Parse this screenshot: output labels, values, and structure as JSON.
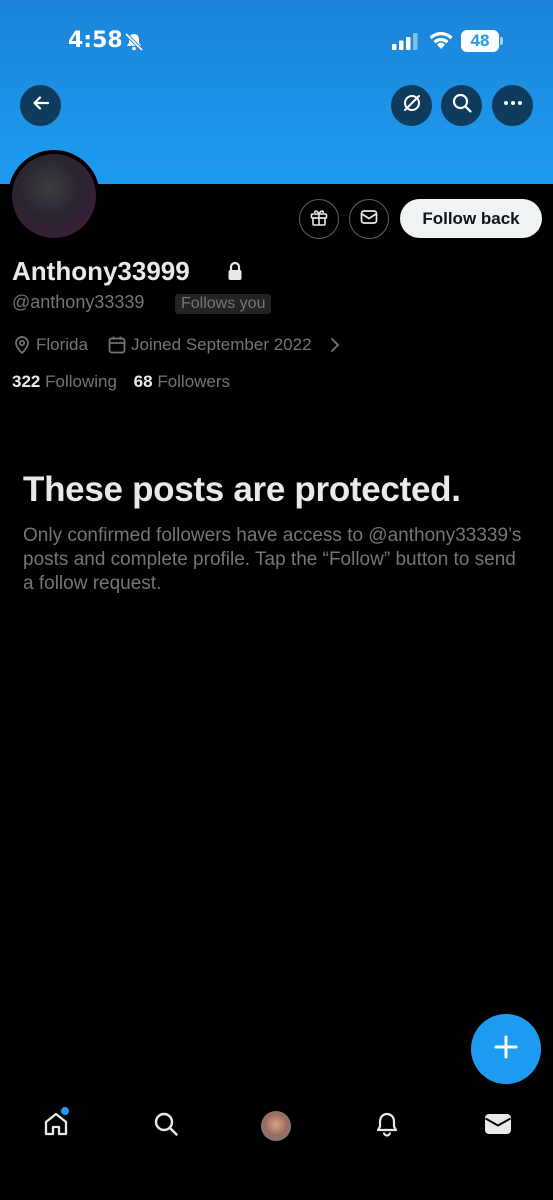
{
  "status_bar": {
    "time": "4:58",
    "battery": "48"
  },
  "profile": {
    "display_name": "Anthony33999",
    "handle": "@anthony33339",
    "follows_you": "Follows you",
    "location": "Florida",
    "joined": "Joined September 2022",
    "following_count": "322",
    "following_label": "Following",
    "followers_count": "68",
    "followers_label": "Followers"
  },
  "actions": {
    "follow_back": "Follow back"
  },
  "protected": {
    "title": "These posts are protected.",
    "body": "Only confirmed followers have access to @anthony33339’s posts and complete profile. Tap the “Follow” button to send a follow request."
  },
  "colors": {
    "accent": "#1d9bf0",
    "background": "#000000",
    "muted_text": "#71767b"
  },
  "icons": [
    "back-arrow-icon",
    "grok-icon",
    "search-icon",
    "more-icon",
    "gift-icon",
    "message-icon",
    "lock-icon",
    "location-icon",
    "calendar-icon",
    "chevron-right-icon",
    "plus-icon",
    "home-icon",
    "explore-icon",
    "notifications-icon",
    "messages-icon"
  ]
}
